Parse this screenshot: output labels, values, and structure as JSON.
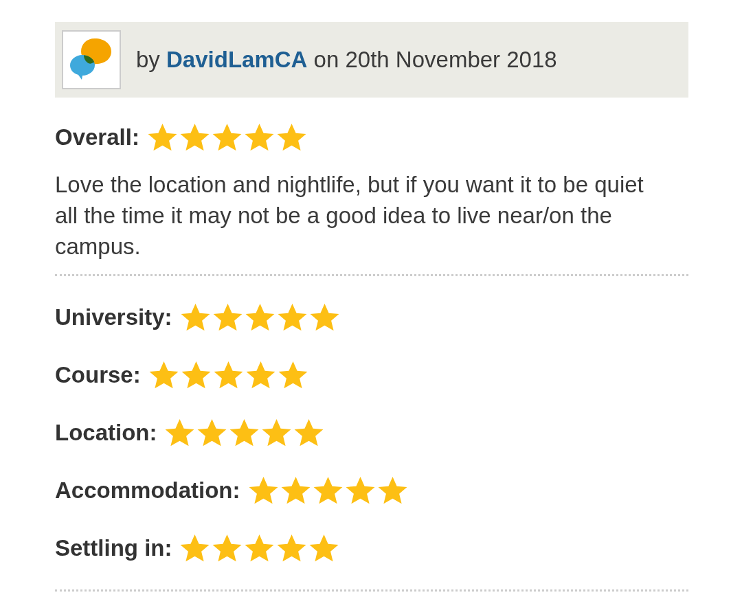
{
  "review": {
    "prefix": "by",
    "author": "DavidLamCA",
    "date": "on 20th November 2018"
  },
  "overall": {
    "label": "Overall:",
    "stars": 5
  },
  "comment": "Love the location and nightlife, but if you want it to be quiet all the time it may not be a good idea to live near/on the campus.",
  "ratings": [
    {
      "label": "University:",
      "stars": 5
    },
    {
      "label": "Course:",
      "stars": 5
    },
    {
      "label": "Location:",
      "stars": 5
    },
    {
      "label": "Accommodation:",
      "stars": 5
    },
    {
      "label": "Settling in:",
      "stars": 5
    }
  ]
}
